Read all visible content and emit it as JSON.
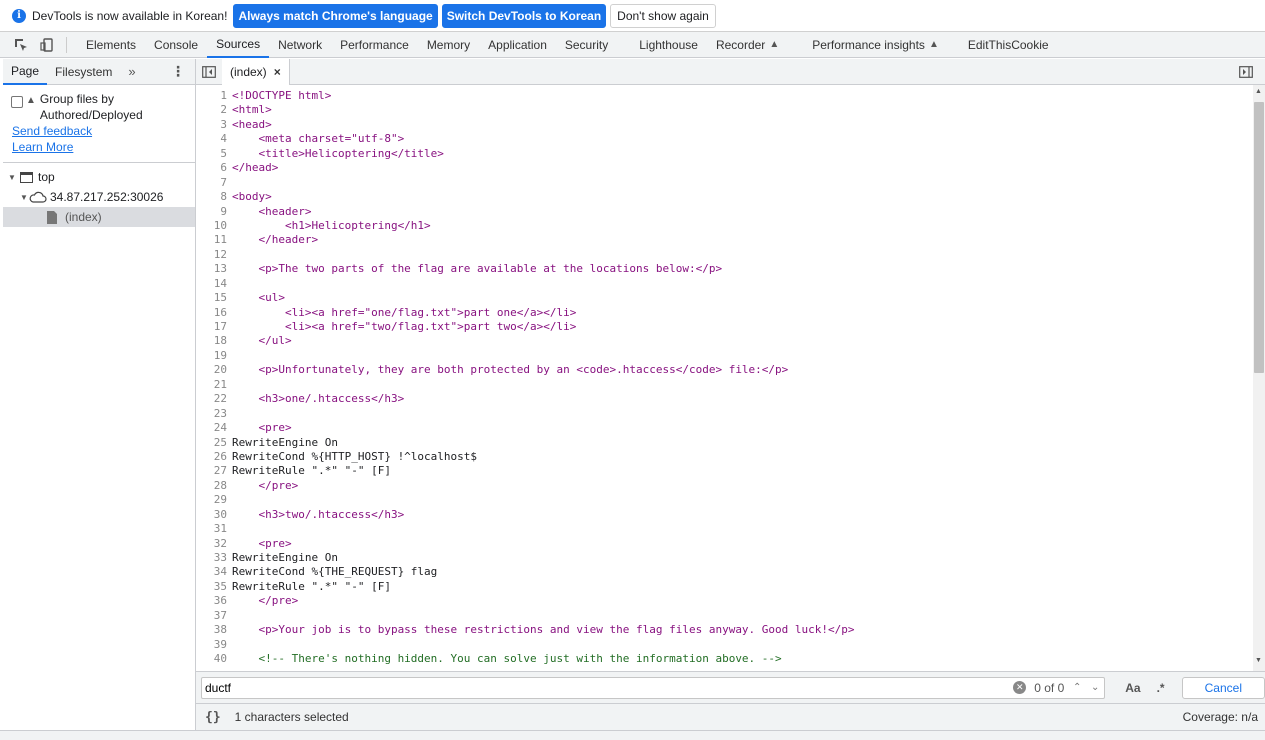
{
  "infobar": {
    "message": "DevTools is now available in Korean!",
    "match_language": "Always match Chrome's language",
    "switch_korean": "Switch DevTools to Korean",
    "dont_show": "Don't show again"
  },
  "tabs": [
    "Elements",
    "Console",
    "Sources",
    "Network",
    "Performance",
    "Memory",
    "Application",
    "Security",
    "Lighthouse",
    "Recorder",
    "Performance insights",
    "EditThisCookie"
  ],
  "active_tab": "Sources",
  "sidebar": {
    "tabs": [
      "Page",
      "Filesystem"
    ],
    "more": "»",
    "group_label_1": "Group files by",
    "group_label_2": "Authored/Deployed",
    "send_feedback": "Send feedback",
    "learn_more": "Learn More",
    "tree": {
      "top": "top",
      "host": "34.87.217.252:30026",
      "file": "(index)"
    }
  },
  "editor": {
    "file_tab": "(index)",
    "close": "×",
    "lines": [
      {
        "n": "1",
        "t": "<!DOCTYPE html>"
      },
      {
        "n": "2",
        "t": "<html>"
      },
      {
        "n": "3",
        "t": "<head>"
      },
      {
        "n": "4",
        "t": "    <meta charset=\"utf-8\">"
      },
      {
        "n": "5",
        "t": "    <title>Helicoptering</title>"
      },
      {
        "n": "6",
        "t": "</head>"
      },
      {
        "n": "7",
        "t": ""
      },
      {
        "n": "8",
        "t": "<body>"
      },
      {
        "n": "9",
        "t": "    <header>"
      },
      {
        "n": "10",
        "t": "        <h1>Helicoptering</h1>"
      },
      {
        "n": "11",
        "t": "    </header>"
      },
      {
        "n": "12",
        "t": ""
      },
      {
        "n": "13",
        "t": "    <p>The two parts of the flag are available at the locations below:</p>"
      },
      {
        "n": "14",
        "t": ""
      },
      {
        "n": "15",
        "t": "    <ul>"
      },
      {
        "n": "16",
        "t": "        <li><a href=\"one/flag.txt\">part one</a></li>"
      },
      {
        "n": "17",
        "t": "        <li><a href=\"two/flag.txt\">part two</a></li>"
      },
      {
        "n": "18",
        "t": "    </ul>"
      },
      {
        "n": "19",
        "t": ""
      },
      {
        "n": "20",
        "t": "    <p>Unfortunately, they are both protected by an <code>.htaccess</code> file:</p>"
      },
      {
        "n": "21",
        "t": ""
      },
      {
        "n": "22",
        "t": "    <h3>one/.htaccess</h3>"
      },
      {
        "n": "23",
        "t": ""
      },
      {
        "n": "24",
        "t": "    <pre>"
      },
      {
        "n": "25",
        "t": "RewriteEngine On"
      },
      {
        "n": "26",
        "t": "RewriteCond %{HTTP_HOST} !^localhost$"
      },
      {
        "n": "27",
        "t": "RewriteRule \".*\" \"-\" [F]"
      },
      {
        "n": "28",
        "t": "    </pre>"
      },
      {
        "n": "29",
        "t": ""
      },
      {
        "n": "30",
        "t": "    <h3>two/.htaccess</h3>"
      },
      {
        "n": "31",
        "t": ""
      },
      {
        "n": "32",
        "t": "    <pre>"
      },
      {
        "n": "33",
        "t": "RewriteEngine On"
      },
      {
        "n": "34",
        "t": "RewriteCond %{THE_REQUEST} flag"
      },
      {
        "n": "35",
        "t": "RewriteRule \".*\" \"-\" [F]"
      },
      {
        "n": "36",
        "t": "    </pre>"
      },
      {
        "n": "37",
        "t": ""
      },
      {
        "n": "38",
        "t": "    <p>Your job is to bypass these restrictions and view the flag files anyway. Good luck!</p>"
      },
      {
        "n": "39",
        "t": ""
      },
      {
        "n": "40",
        "t": "    <!-- There's nothing hidden. You can solve just with the information above. -->"
      }
    ]
  },
  "search": {
    "value": "ductf",
    "match_count": "0 of 0",
    "case_label": "Aa",
    "regex_label": ".*",
    "cancel": "Cancel"
  },
  "status": {
    "braces": "{}",
    "selected": "1 characters selected",
    "coverage": "Coverage: n/a"
  },
  "colors": {
    "accent": "#1a73e8",
    "code_tag": "#881280"
  }
}
